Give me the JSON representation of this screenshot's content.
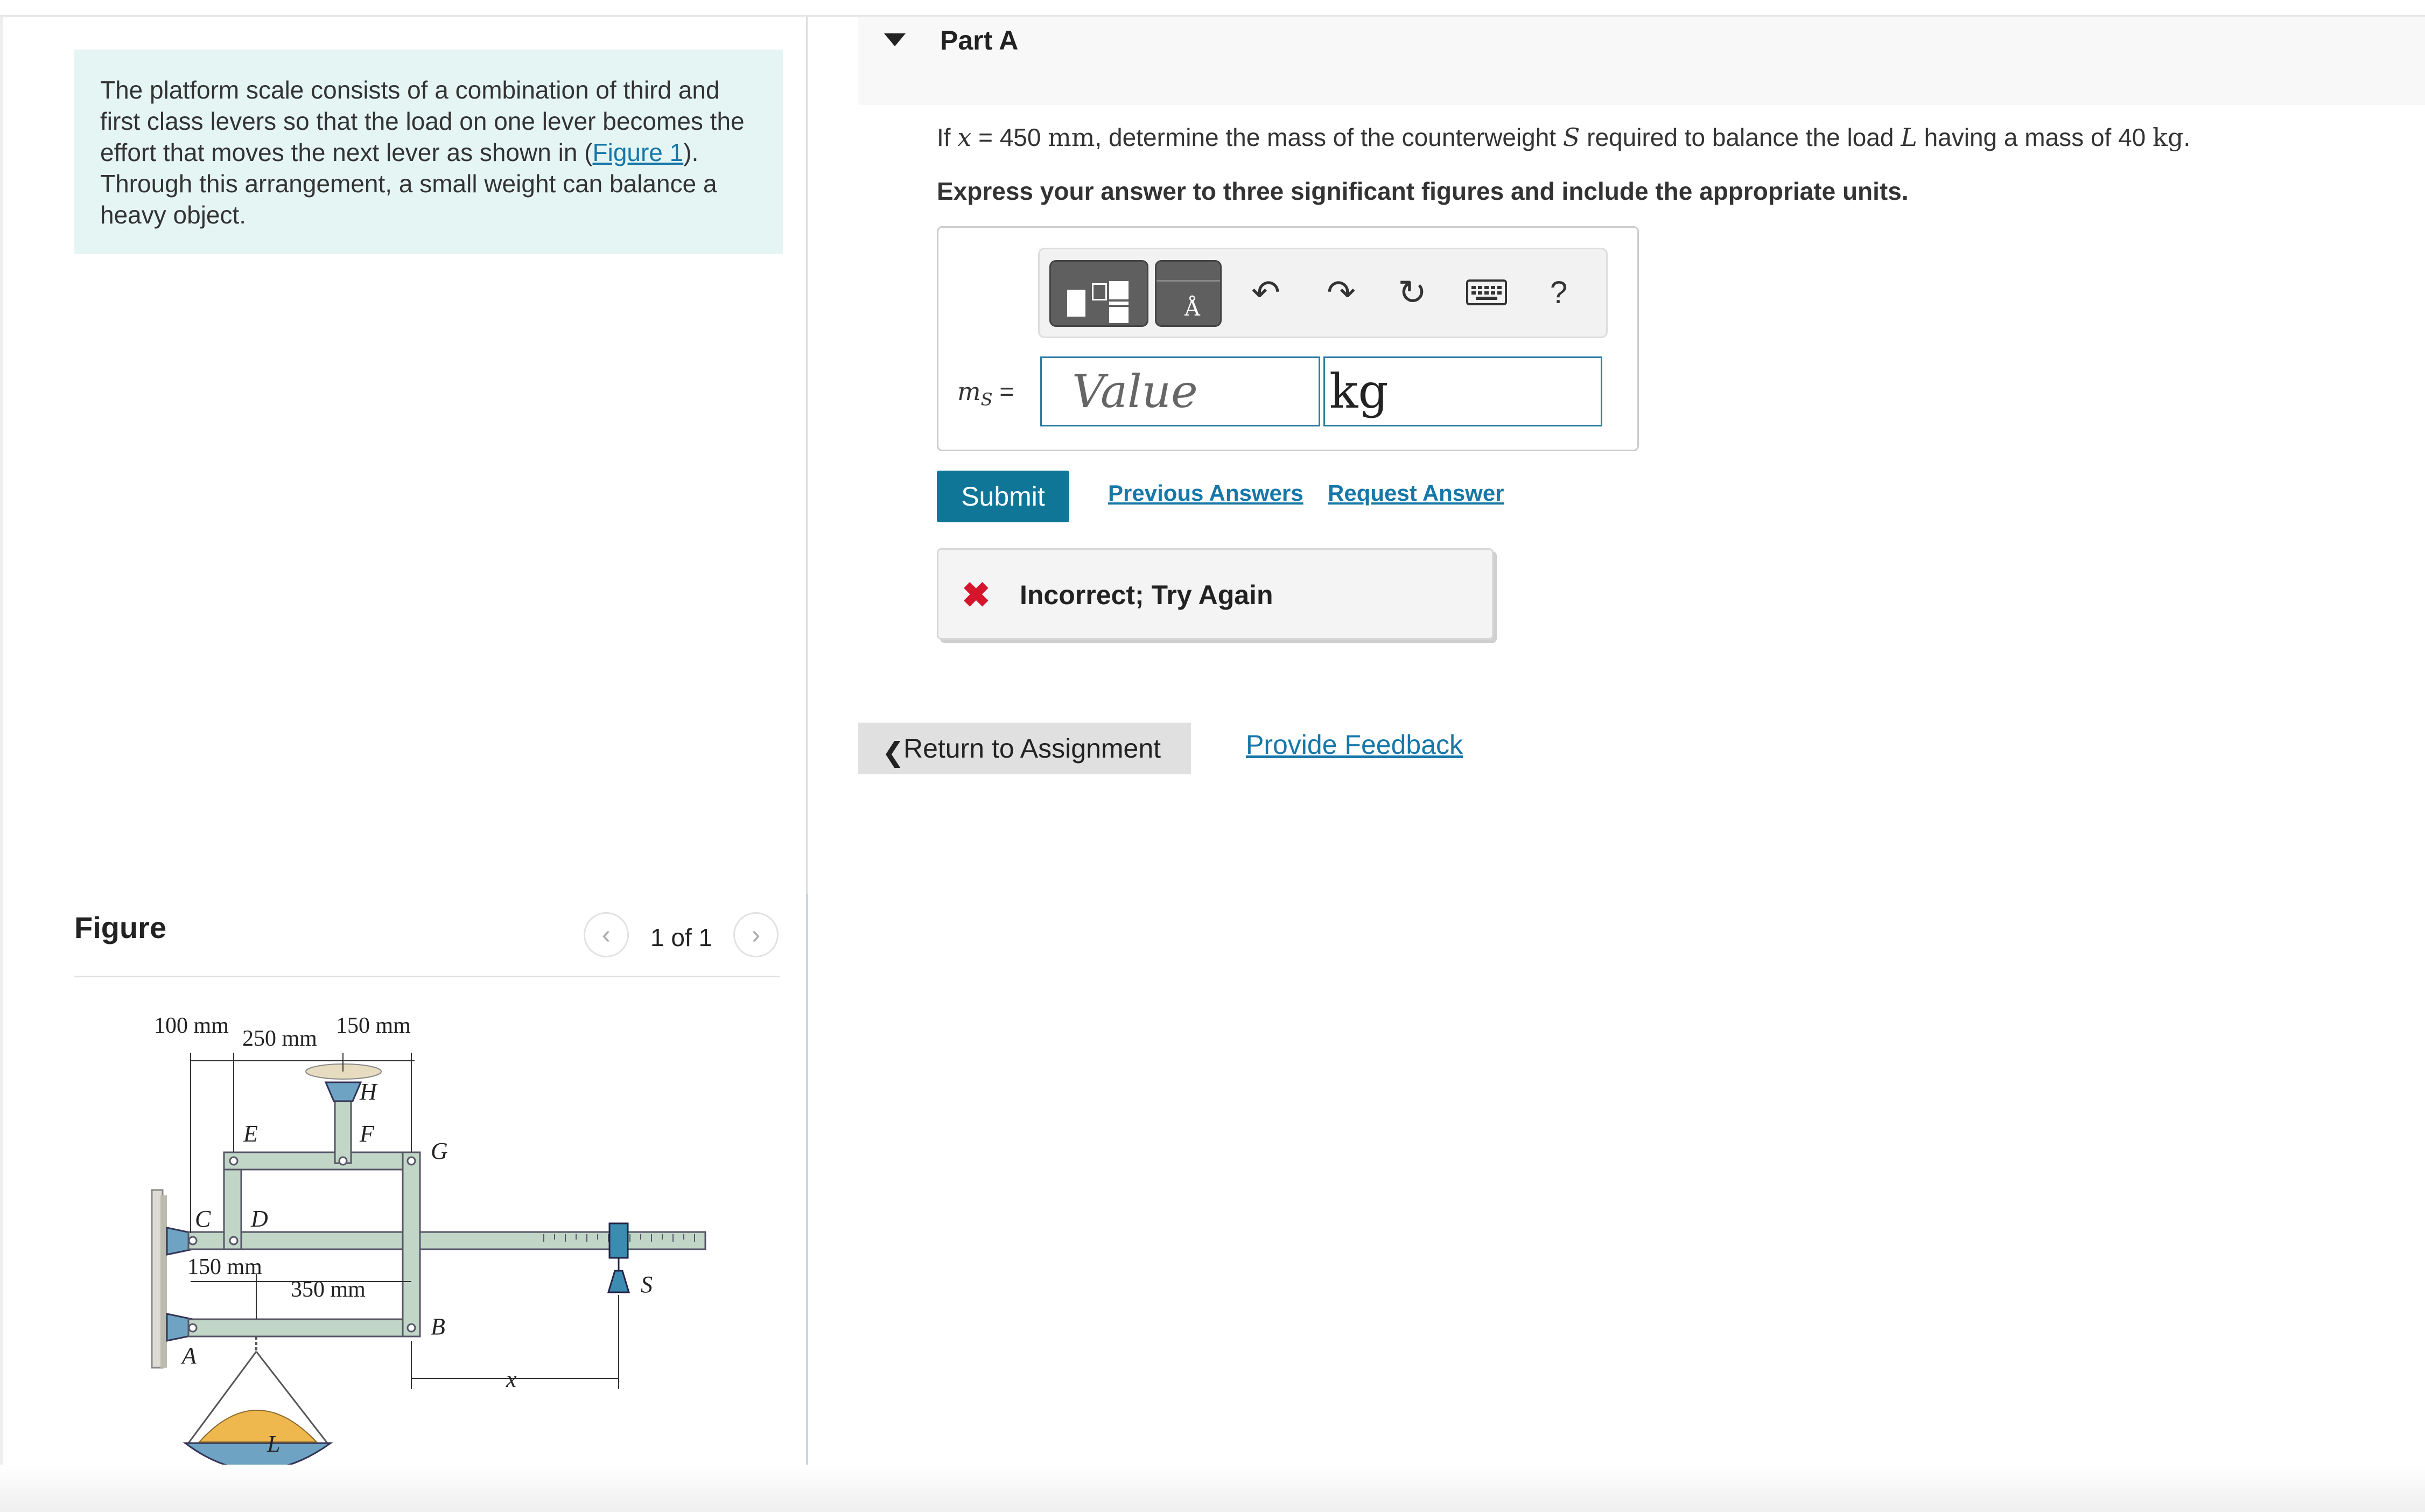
{
  "intro": {
    "text_before": "The platform scale consists of a combination of third and first class levers so that the load on one lever becomes the effort that moves the next lever as shown in (",
    "link": "Figure 1",
    "text_after": "). Through this arrangement, a small weight can balance a heavy object."
  },
  "figure": {
    "title": "Figure",
    "counter": "1 of 1",
    "labels": {
      "d100": "100 mm",
      "d250": "250 mm",
      "d150a": "150 mm",
      "d150b": "150 mm",
      "d350": "350 mm",
      "H": "H",
      "E": "E",
      "F": "F",
      "G": "G",
      "C": "C",
      "D": "D",
      "A": "A",
      "B": "B",
      "S": "S",
      "L": "L",
      "x": "x"
    }
  },
  "part": {
    "title": "Part A",
    "q1": "If ",
    "qx": "x",
    "q2": " = 450 ",
    "qmm": "mm",
    "q3": ", determine the mass of the counterweight ",
    "qS": "S",
    "q4": " required to balance the load ",
    "qL": "L",
    "q5": " having a mass of 40 ",
    "qkg": "kg",
    "q6": ".",
    "instruction": "Express your answer to three significant figures and include the appropriate units."
  },
  "answer": {
    "label_m": "m",
    "label_sub": "S",
    "label_eq": " =",
    "value_placeholder": "Value",
    "unit": "kg",
    "help": "?"
  },
  "actions": {
    "submit": "Submit",
    "previous": "Previous Answers",
    "request": "Request Answer"
  },
  "feedback": {
    "icon": "✖",
    "text": "Incorrect; Try Again"
  },
  "footer": {
    "return": "Return to Assignment",
    "provide": "Provide Feedback"
  },
  "colors": {
    "accent": "#0f7698",
    "link": "#1677a8",
    "error": "#d5152c",
    "intro_bg": "#e5f5f4"
  },
  "icons": [
    "templates-icon",
    "symbols-icon",
    "undo-icon",
    "redo-icon",
    "reset-icon",
    "keyboard-icon",
    "help-icon",
    "collapse-arrow-icon",
    "chevron-left-icon",
    "chevron-right-icon",
    "error-x-icon"
  ]
}
